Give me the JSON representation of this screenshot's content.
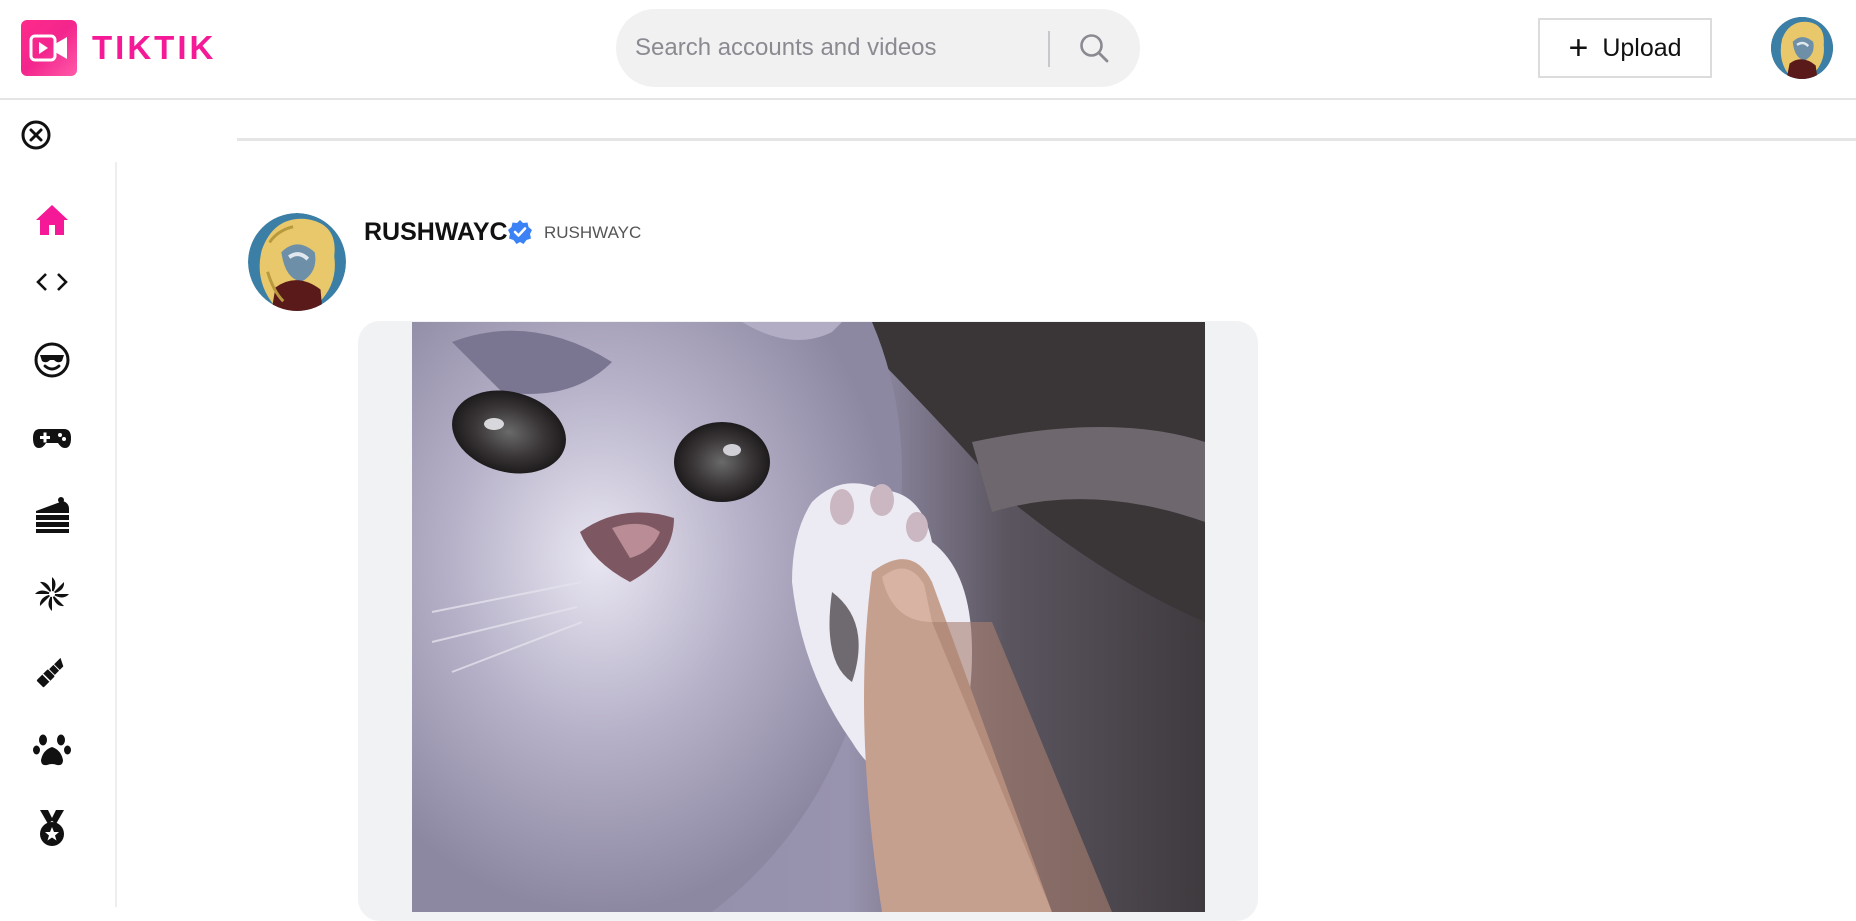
{
  "header": {
    "logo_text": "TIKTIK",
    "search_placeholder": "Search accounts and videos",
    "upload_label": "Upload"
  },
  "sidebar": {
    "items": [
      {
        "icon": "home-icon",
        "active": true
      },
      {
        "icon": "code-icon",
        "active": false
      },
      {
        "icon": "comedy-icon",
        "active": false
      },
      {
        "icon": "gaming-icon",
        "active": false
      },
      {
        "icon": "food-icon",
        "active": false
      },
      {
        "icon": "dance-icon",
        "active": false
      },
      {
        "icon": "beauty-icon",
        "active": false
      },
      {
        "icon": "animals-icon",
        "active": false
      },
      {
        "icon": "sports-icon",
        "active": false
      }
    ]
  },
  "post": {
    "user_name": "RUSHWAYC",
    "user_handle": "RUSHWAYC",
    "verified": true
  },
  "colors": {
    "brand": "#f51997",
    "verified": "#3b82f6",
    "card_bg": "#f1f2f4"
  }
}
